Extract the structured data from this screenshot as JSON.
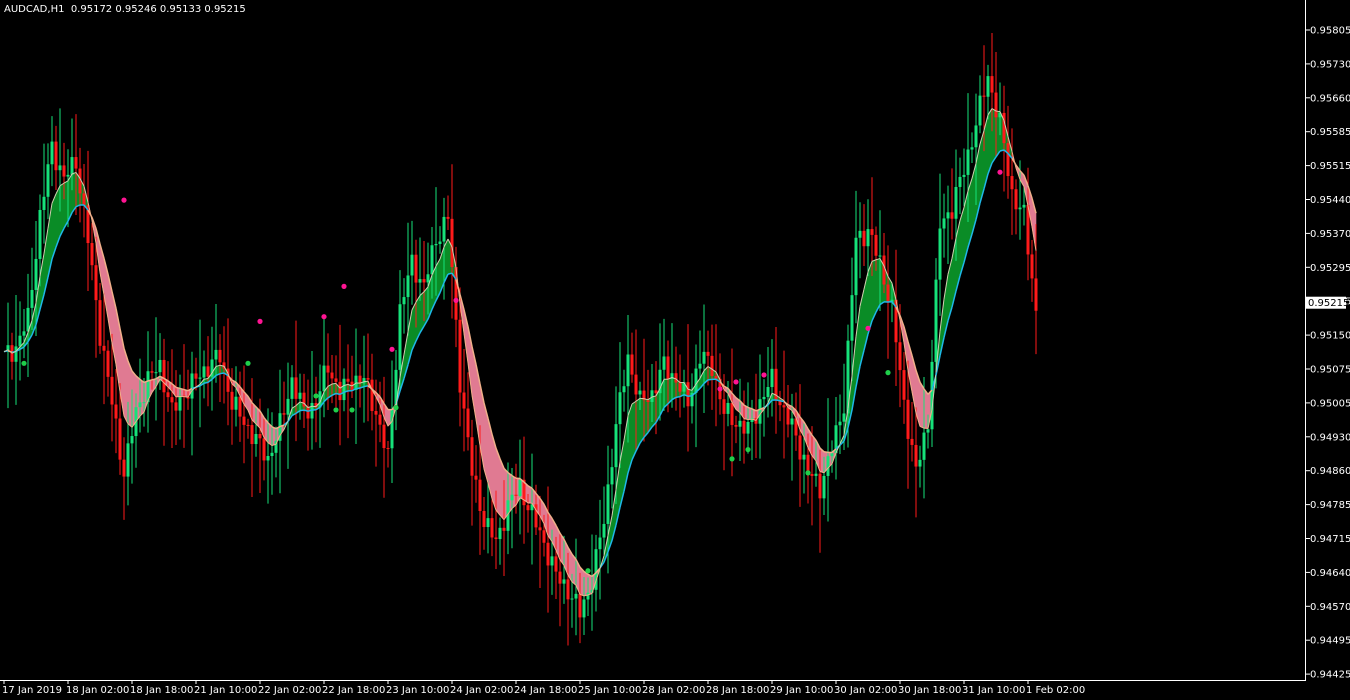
{
  "window": {
    "symbol": "AUDCAD,H1",
    "ohlc": "0.95172 0.95246 0.95133 0.95215"
  },
  "colors": {
    "background": "#000000",
    "axis": "#ffffff",
    "bull_candle": "#16e27a",
    "bear_candle": "#ff1a1a",
    "ribbon_up": "#0a8c26",
    "ribbon_down": "#e07a92",
    "fast_line": "#1fb8e8",
    "slow_line_up": "#cfcfb0",
    "slow_line_down": "#f0b08a",
    "dot_buy": "#1fcf4a",
    "dot_sell": "#ff1493",
    "price_tag_bg": "#ffffff",
    "price_tag_fg": "#000000"
  },
  "chart_data": {
    "type": "candlestick",
    "title": "AUDCAD,H1  0.95172 0.95246 0.95133 0.95215",
    "current_price": "0.95215",
    "ylim": [
      0.9444,
      0.9583
    ],
    "y_ticks": [
      "0.95805",
      "0.95730",
      "0.95660",
      "0.95585",
      "0.95515",
      "0.95440",
      "0.95370",
      "0.95295",
      "0.95225",
      "0.95150",
      "0.95075",
      "0.95005",
      "0.94930",
      "0.94860",
      "0.94785",
      "0.94715",
      "0.94640",
      "0.94570",
      "0.94495",
      "0.94425"
    ],
    "x_ticks": [
      "17 Jan 2019",
      "18 Jan 02:00",
      "18 Jan 18:00",
      "21 Jan 10:00",
      "22 Jan 02:00",
      "22 Jan 18:00",
      "23 Jan 10:00",
      "24 Jan 02:00",
      "24 Jan 18:00",
      "25 Jan 10:00",
      "28 Jan 02:00",
      "28 Jan 18:00",
      "29 Jan 10:00",
      "30 Jan 02:00",
      "30 Jan 18:00",
      "31 Jan 10:00",
      "1 Feb 02:00"
    ],
    "bars_per_tick": 16,
    "close_path": [
      [
        0,
        0.951
      ],
      [
        3,
        0.9512
      ],
      [
        6,
        0.9518
      ],
      [
        9,
        0.954
      ],
      [
        12,
        0.9555
      ],
      [
        15,
        0.9548
      ],
      [
        18,
        0.9552
      ],
      [
        21,
        0.9535
      ],
      [
        24,
        0.9515
      ],
      [
        27,
        0.95
      ],
      [
        30,
        0.9485
      ],
      [
        33,
        0.9498
      ],
      [
        36,
        0.9505
      ],
      [
        39,
        0.9508
      ],
      [
        42,
        0.9498
      ],
      [
        45,
        0.9502
      ],
      [
        48,
        0.9505
      ],
      [
        51,
        0.9508
      ],
      [
        54,
        0.951
      ],
      [
        57,
        0.95
      ],
      [
        60,
        0.9496
      ],
      [
        63,
        0.9492
      ],
      [
        66,
        0.9488
      ],
      [
        69,
        0.9495
      ],
      [
        72,
        0.9505
      ],
      [
        75,
        0.9498
      ],
      [
        78,
        0.95
      ],
      [
        81,
        0.9508
      ],
      [
        84,
        0.9502
      ],
      [
        87,
        0.9505
      ],
      [
        90,
        0.9505
      ],
      [
        93,
        0.9498
      ],
      [
        96,
        0.9488
      ],
      [
        99,
        0.952
      ],
      [
        102,
        0.953
      ],
      [
        105,
        0.9525
      ],
      [
        108,
        0.9535
      ],
      [
        111,
        0.954
      ],
      [
        114,
        0.9505
      ],
      [
        117,
        0.9485
      ],
      [
        120,
        0.9475
      ],
      [
        123,
        0.947
      ],
      [
        126,
        0.9478
      ],
      [
        129,
        0.9482
      ],
      [
        132,
        0.9476
      ],
      [
        135,
        0.947
      ],
      [
        138,
        0.9463
      ],
      [
        141,
        0.946
      ],
      [
        144,
        0.9455
      ],
      [
        147,
        0.9462
      ],
      [
        150,
        0.9475
      ],
      [
        153,
        0.9495
      ],
      [
        156,
        0.951
      ],
      [
        159,
        0.95
      ],
      [
        162,
        0.9502
      ],
      [
        165,
        0.9508
      ],
      [
        168,
        0.9505
      ],
      [
        171,
        0.95
      ],
      [
        174,
        0.951
      ],
      [
        177,
        0.9508
      ],
      [
        180,
        0.9498
      ],
      [
        183,
        0.9496
      ],
      [
        186,
        0.9494
      ],
      [
        189,
        0.95
      ],
      [
        192,
        0.9505
      ],
      [
        195,
        0.9498
      ],
      [
        198,
        0.9493
      ],
      [
        201,
        0.9485
      ],
      [
        204,
        0.9482
      ],
      [
        207,
        0.949
      ],
      [
        210,
        0.95
      ],
      [
        213,
        0.9535
      ],
      [
        216,
        0.9537
      ],
      [
        219,
        0.953
      ],
      [
        222,
        0.952
      ],
      [
        225,
        0.95
      ],
      [
        228,
        0.9485
      ],
      [
        231,
        0.9496
      ],
      [
        234,
        0.9538
      ],
      [
        237,
        0.9542
      ],
      [
        240,
        0.955
      ],
      [
        243,
        0.956
      ],
      [
        246,
        0.957
      ],
      [
        249,
        0.956
      ],
      [
        252,
        0.9545
      ],
      [
        255,
        0.954
      ],
      [
        258,
        0.952
      ]
    ],
    "dots": [
      {
        "bar": 5,
        "value": 0.95085,
        "kind": "buy"
      },
      {
        "bar": 30,
        "value": 0.95435,
        "kind": "sell"
      },
      {
        "bar": 61,
        "value": 0.95085,
        "kind": "buy"
      },
      {
        "bar": 64,
        "value": 0.95175,
        "kind": "sell"
      },
      {
        "bar": 78,
        "value": 0.95015,
        "kind": "buy"
      },
      {
        "bar": 80,
        "value": 0.95185,
        "kind": "sell"
      },
      {
        "bar": 83,
        "value": 0.94985,
        "kind": "buy"
      },
      {
        "bar": 85,
        "value": 0.9525,
        "kind": "sell"
      },
      {
        "bar": 87,
        "value": 0.94985,
        "kind": "buy"
      },
      {
        "bar": 97,
        "value": 0.95115,
        "kind": "sell"
      },
      {
        "bar": 98,
        "value": 0.9499,
        "kind": "buy"
      },
      {
        "bar": 113,
        "value": 0.9522,
        "kind": "sell"
      },
      {
        "bar": 146,
        "value": 0.9464,
        "kind": "buy"
      },
      {
        "bar": 179,
        "value": 0.9503,
        "kind": "sell"
      },
      {
        "bar": 182,
        "value": 0.9488,
        "kind": "buy"
      },
      {
        "bar": 183,
        "value": 0.95045,
        "kind": "sell"
      },
      {
        "bar": 186,
        "value": 0.949,
        "kind": "buy"
      },
      {
        "bar": 190,
        "value": 0.9506,
        "kind": "sell"
      },
      {
        "bar": 201,
        "value": 0.9485,
        "kind": "buy"
      },
      {
        "bar": 216,
        "value": 0.9516,
        "kind": "sell"
      },
      {
        "bar": 221,
        "value": 0.95065,
        "kind": "buy"
      },
      {
        "bar": 249,
        "value": 0.95495,
        "kind": "sell"
      }
    ]
  }
}
